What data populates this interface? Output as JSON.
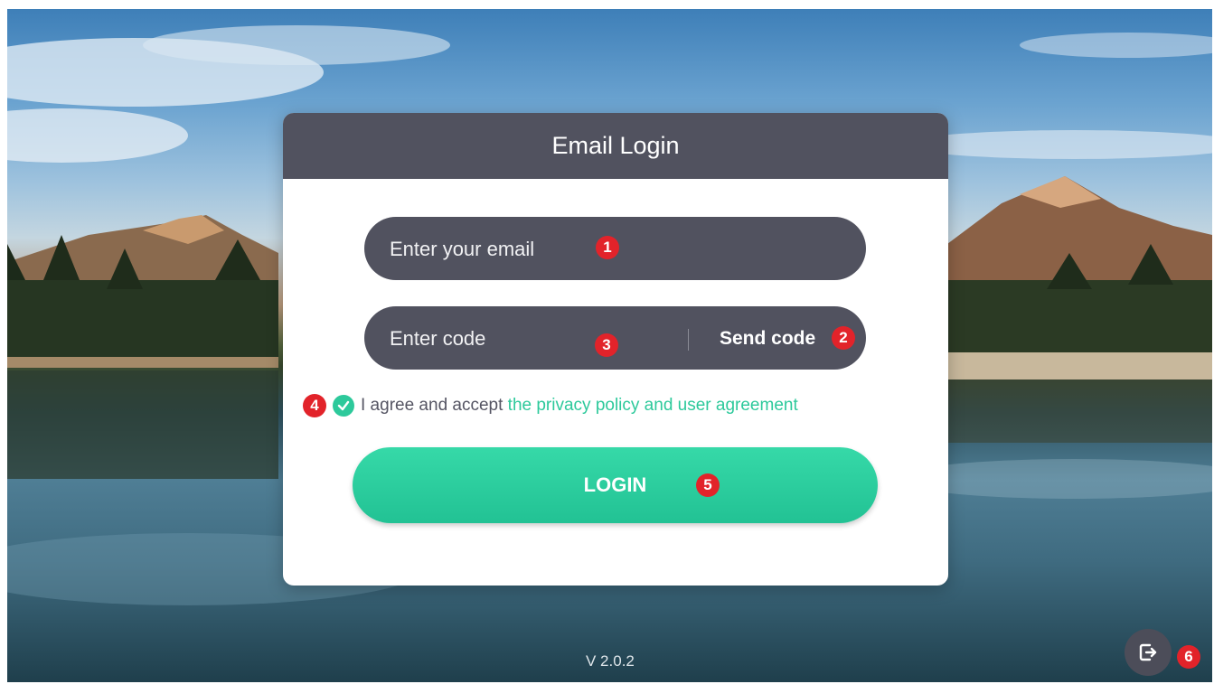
{
  "dialog": {
    "title": "Email Login",
    "email_placeholder": "Enter your email",
    "code_placeholder": "Enter code",
    "send_code_label": "Send code",
    "agree_text": "I agree and accept ",
    "agree_link": "the privacy policy and user agreement",
    "login_label": "LOGIN"
  },
  "annotations": [
    "1",
    "2",
    "3",
    "4",
    "5",
    "6"
  ],
  "footer": {
    "version": "V 2.0.2"
  },
  "icons": {
    "check": "checkmark-icon",
    "exit": "exit-icon"
  },
  "colors": {
    "header": "#51525f",
    "accent": "#2dc99b",
    "badge": "#e2232a"
  }
}
